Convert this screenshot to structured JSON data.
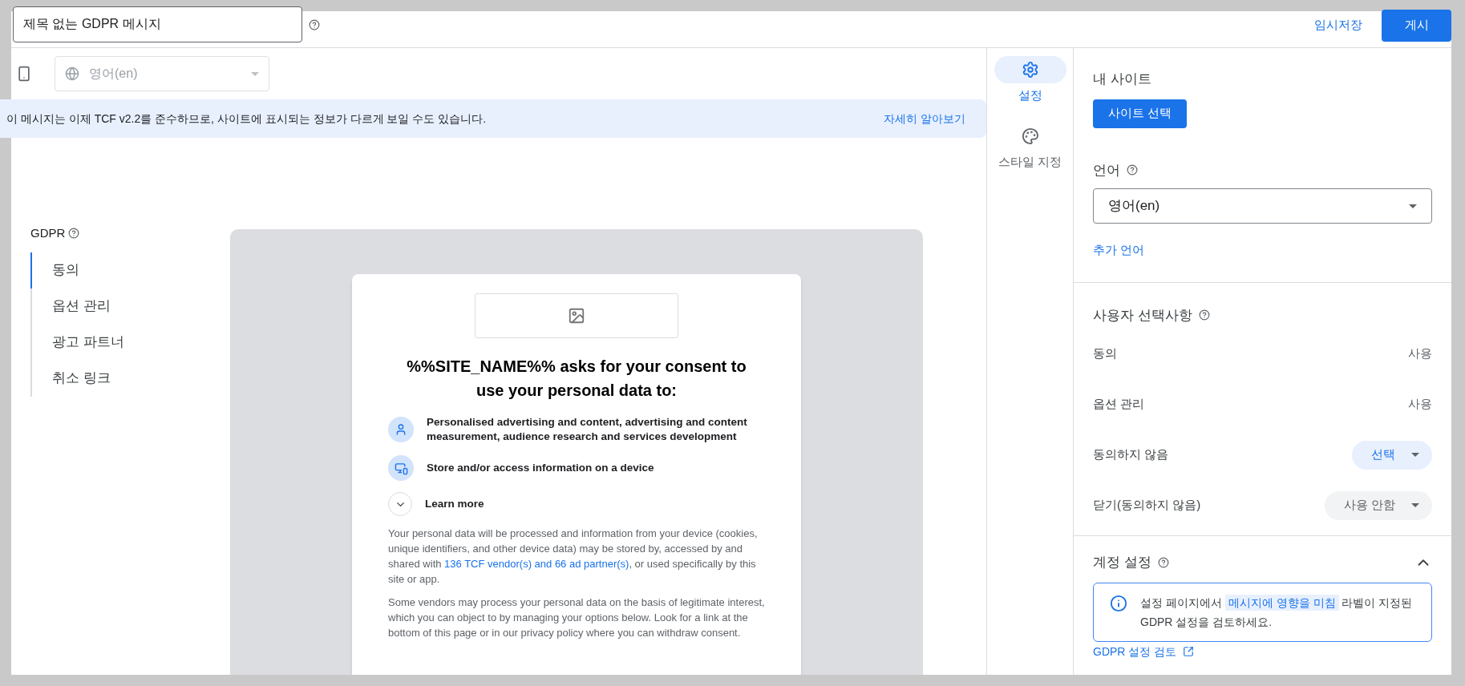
{
  "header": {
    "title_value": "제목 없는 GDPR 메시지",
    "save_draft": "임시저장",
    "publish": "게시"
  },
  "toolbar": {
    "language": "영어(en)"
  },
  "banner": {
    "text": "이 메시지는 이제 TCF v2.2를 준수하므로, 사이트에 표시되는 정보가 다르게 보일 수도 있습니다.",
    "link": "자세히 알아보기"
  },
  "nav": {
    "title": "GDPR",
    "items": [
      {
        "label": "동의",
        "selected": true
      },
      {
        "label": "옵션 관리",
        "selected": false
      },
      {
        "label": "광고 파트너",
        "selected": false
      },
      {
        "label": "취소 링크",
        "selected": false
      }
    ]
  },
  "preview": {
    "heading": "%%SITE_NAME%% asks for your consent to use your personal data to:",
    "purposes": [
      {
        "kind": "person",
        "text": "Personalised advertising and content, advertising and content measurement, audience research and services development"
      },
      {
        "kind": "device",
        "text": "Store and/or access information on a device"
      }
    ],
    "learn_more": "Learn more",
    "paragraph_1": {
      "before": "Your personal data will be processed and information from your device (cookies, unique identifiers, and other device data) may be stored by, accessed by and shared with",
      "link": "136 TCF vendor(s) and 66 ad partner(s)",
      "after": ", or used specifically by this site or app."
    },
    "paragraph_2": "Some vendors may process your personal data on the basis of legitimate interest, which you can object to by managing your options below. Look for a link at the bottom of this page or in our privacy policy where you can withdraw consent."
  },
  "rail": [
    {
      "kind": "settings",
      "label": "설정",
      "selected": true
    },
    {
      "kind": "style",
      "label": "스타일 지정",
      "selected": false
    }
  ],
  "settings": {
    "my_site": {
      "title": "내 사이트",
      "button": "사이트 선택"
    },
    "language": {
      "title": "언어",
      "value": "영어(en)",
      "add_link": "추가 언어"
    },
    "user_choices": {
      "title": "사용자 선택사항",
      "rows": [
        {
          "label": "동의",
          "kind": "text",
          "value": "사용"
        },
        {
          "label": "옵션 관리",
          "kind": "text",
          "value": "사용"
        },
        {
          "label": "동의하지 않음",
          "kind": "dropdown",
          "value": "선택",
          "active": true
        },
        {
          "label": "닫기(동의하지 않음)",
          "kind": "dropdown",
          "value": "사용 안함",
          "active": false
        }
      ]
    },
    "account": {
      "title": "계정 설정",
      "expanded": true,
      "info": {
        "before": "설정 페이지에서",
        "chip": "메시지에 영향을 미침",
        "after": "라벨이 지정된 GDPR 설정을 검토하세요."
      },
      "link": "GDPR 설정 검토"
    }
  }
}
